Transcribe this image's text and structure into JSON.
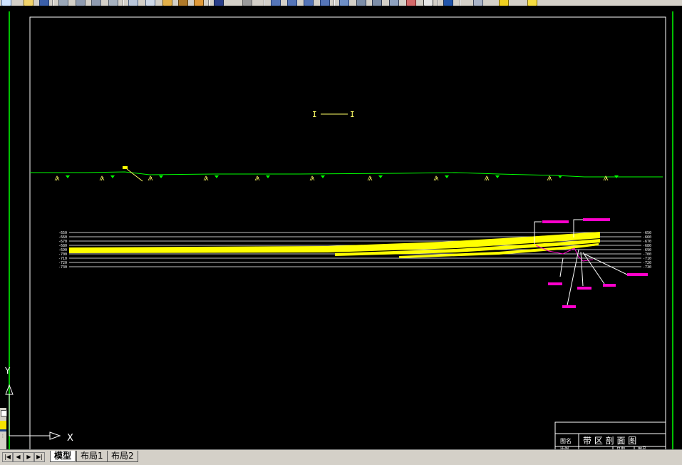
{
  "toolbar": {
    "icons": [
      "new-icon",
      "open-icon",
      "save-icon",
      "plot-icon",
      "preview-icon",
      "publish-icon",
      "cut-icon",
      "copy-icon",
      "paste-icon",
      "match-icon",
      "undo-icon",
      "redo-icon",
      "pan-icon",
      "zoom-realtime-icon",
      "zoom-window-icon",
      "zoom-previous-icon",
      "properties-icon",
      "design-center-icon",
      "tool-palette-icon",
      "sheet-set-icon",
      "markup-icon",
      "calculator-icon",
      "help-icon",
      "layer-icon",
      "layer-state-icon",
      "lock-icon"
    ]
  },
  "drawing": {
    "section_label": "I —— I",
    "section_left": "I",
    "section_right": "I",
    "elevations_left": [
      "-650",
      "-660",
      "-670",
      "-680",
      "-690",
      "-700",
      "-710",
      "-720",
      "-730"
    ],
    "elevations_right": [
      "-650",
      "-660",
      "-670",
      "-680",
      "-690",
      "-700",
      "-710",
      "-720",
      "-730"
    ],
    "ucs_x": "X",
    "ucs_y": "Y"
  },
  "title_block": {
    "label_name": "图名",
    "title": "带 区 剖 面 图",
    "label_row2_a": "比例",
    "label_row2_b": "日期",
    "label_row2_c": "图号"
  },
  "tabs": {
    "nav": [
      "|◀",
      "◀",
      "▶",
      "▶|"
    ],
    "items": [
      {
        "label": "模型",
        "active": true
      },
      {
        "label": "布局1",
        "active": false
      },
      {
        "label": "布局2",
        "active": false
      }
    ]
  },
  "colors": {
    "background": "#000000",
    "frame": "#ffffff",
    "ground": "#00ff00",
    "seam": "#ffff00",
    "callout": "#ff00cc",
    "label": "#ffff66"
  }
}
